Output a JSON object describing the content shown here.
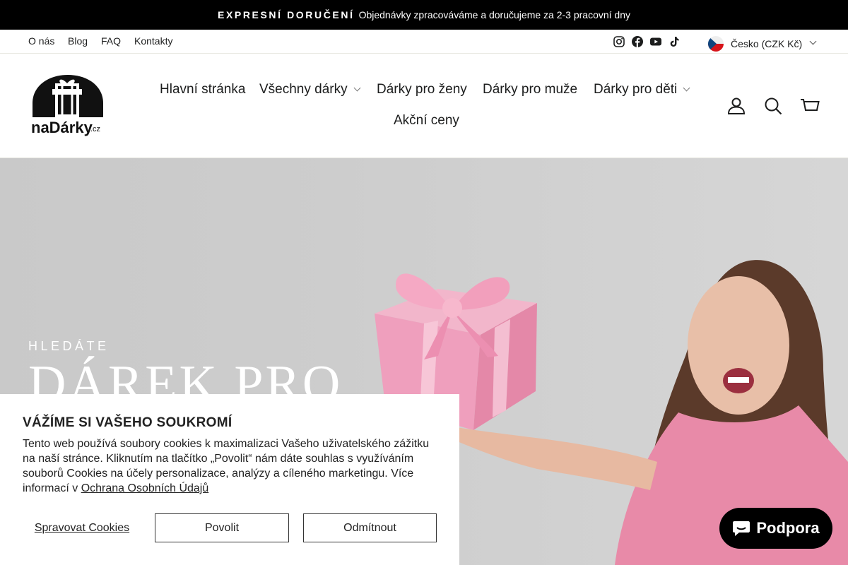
{
  "announcement": {
    "strong": "EXPRESNÍ DORUČENÍ",
    "text": "Objednávky zpracováváme a doručujeme za 2-3 pracovní dny"
  },
  "toolbar": {
    "links": [
      "O nás",
      "Blog",
      "FAQ",
      "Kontakty"
    ],
    "social": [
      "instagram-icon",
      "facebook-icon",
      "youtube-icon",
      "tiktok-icon"
    ],
    "currency": "Česko (CZK Kč)"
  },
  "logo": {
    "text_main": "naDárky",
    "text_suffix": ".cz"
  },
  "nav": {
    "items": [
      "Hlavní stránka",
      "Všechny dárky",
      "Dárky pro ženy",
      "Dárky pro muže",
      "Dárky pro děti",
      "Akční ceny"
    ]
  },
  "header_icons": [
    "account-icon",
    "search-icon",
    "cart-icon"
  ],
  "hero": {
    "subtitle": "HLEDÁTE",
    "title": "DÁREK PRO"
  },
  "cookie": {
    "title": "VÁŽÍME SI VAŠEHO SOUKROMÍ",
    "text": "Tento web používá soubory cookies k maximalizaci Vašeho uživatelského zážitku na naší stránce. Kliknutím na tlačítko „Povolit“ nám dáte souhlas s využíváním souborů Cookies na účely personalizace, analýzy a cíleného marketingu. Více informací v",
    "link": "Ochrana Osobních Údajů",
    "manage": "Spravovat Cookies",
    "accept": "Povolit",
    "reject": "Odmítnout"
  },
  "support": {
    "label": "Podpora"
  },
  "colors": {
    "announcement_bg": "#000000",
    "hero_bg": "#cdcdcd",
    "gift_pink": "#ef9fbd",
    "sweater_pink": "#e88aa8"
  }
}
